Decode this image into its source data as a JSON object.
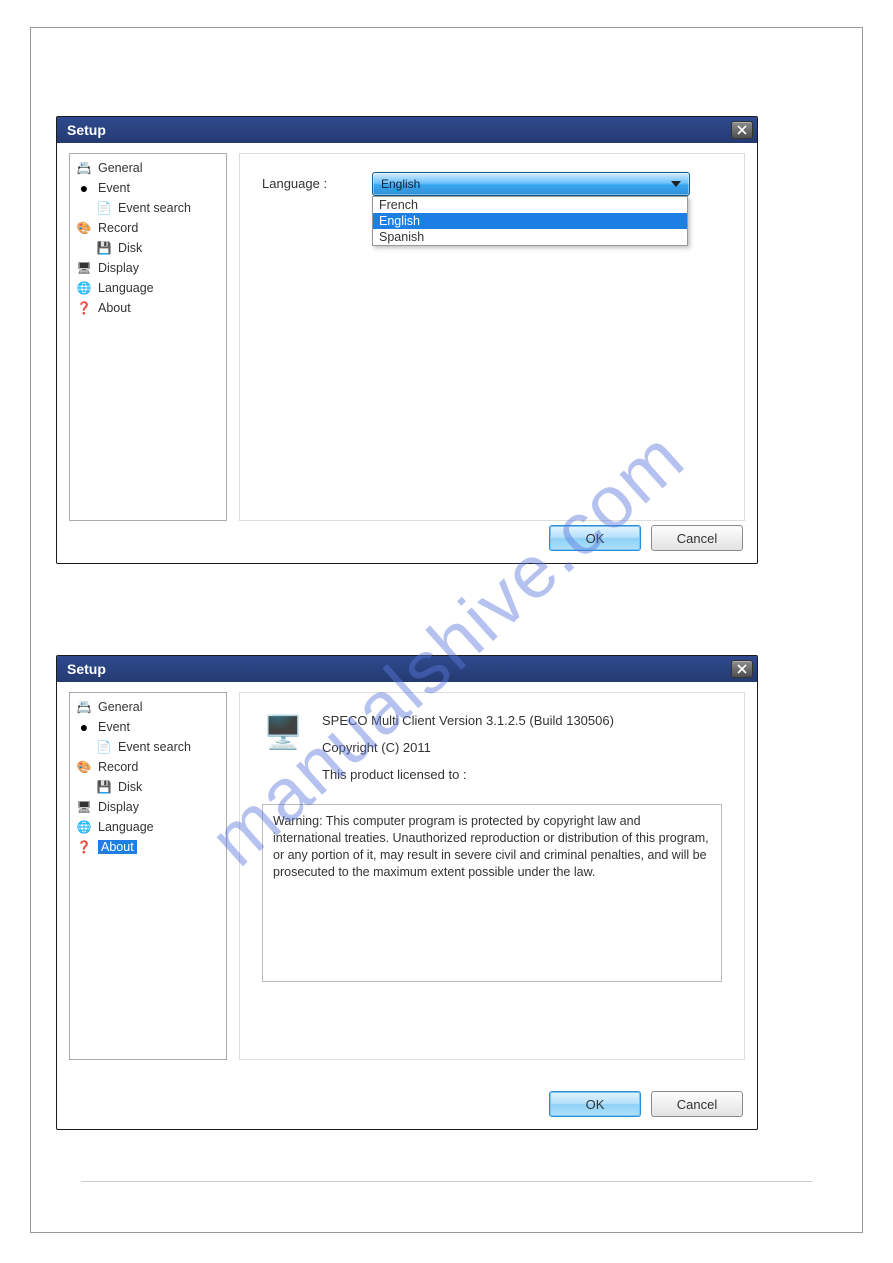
{
  "watermark": "manualshive.com",
  "dialog1": {
    "title": "Setup",
    "tree": {
      "general": "General",
      "event": "Event",
      "event_search": "Event search",
      "record": "Record",
      "disk": "Disk",
      "display": "Display",
      "language": "Language",
      "about": "About"
    },
    "language_label": "Language :",
    "language_selected": "English",
    "language_options": [
      "French",
      "English",
      "Spanish"
    ],
    "ok": "OK",
    "cancel": "Cancel"
  },
  "dialog2": {
    "title": "Setup",
    "tree": {
      "general": "General",
      "event": "Event",
      "event_search": "Event search",
      "record": "Record",
      "disk": "Disk",
      "display": "Display",
      "language": "Language",
      "about": "About"
    },
    "about_version": "SPECO Multi Client Version 3.1.2.5 (Build 130506)",
    "about_copyright": "Copyright (C) 2011",
    "about_licensed": "This product licensed to :",
    "about_warning": "Warning: This computer program is protected by copyright law and international treaties. Unauthorized reproduction or distribution of this program, or any portion of it, may result in severe civil and criminal penalties, and will be prosecuted to the maximum extent possible under the law.",
    "ok": "OK",
    "cancel": "Cancel"
  }
}
